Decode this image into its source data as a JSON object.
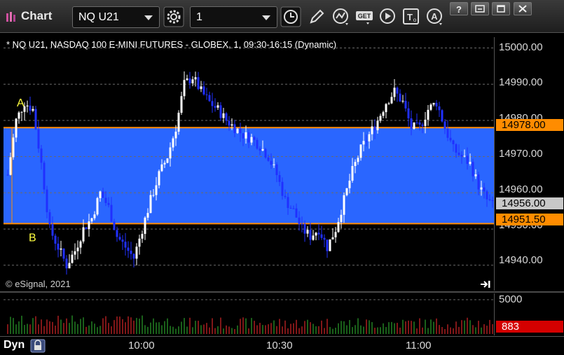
{
  "window": {
    "title": "Chart",
    "symbol_value": "NQ U21",
    "interval_value": "1"
  },
  "toolbar": {
    "icons": [
      "settings-icon",
      "clock-icon",
      "pencil-icon",
      "line-study-icon",
      "get-icon",
      "play-icon",
      "text-tool-icon",
      "alert-icon"
    ]
  },
  "chart": {
    "caption": "* NQ U21, NASDAQ 100 E-MINI FUTURES - GLOBEX, 1, 09:30-16:15 (Dynamic)",
    "copyright": "© eSignal, 2021",
    "marker_a": "A",
    "marker_b": "B",
    "price_ticks": [
      "15000.00",
      "14990.00",
      "14980.00",
      "14970.00",
      "14960.00",
      "14950.00",
      "14940.00"
    ],
    "upper_level": "14978.00",
    "last_price": "14956.00",
    "lower_level": "14951.50",
    "volume_tick": "5000",
    "volume_last": "883",
    "time_labels": [
      "10:00",
      "10:30",
      "11:00"
    ],
    "dyn_label": "Dyn",
    "colors": {
      "band": "#2a66ff",
      "band_border": "#ff8c00",
      "up_bar": "#ffffff",
      "down_bar": "#2030ff",
      "vol_up": "#2ca02c",
      "vol_down": "#d62728"
    }
  },
  "chart_data": {
    "type": "bar",
    "title": "* NQ U21, NASDAQ 100 E-MINI FUTURES - GLOBEX, 1, 09:30-16:15 (Dynamic)",
    "x": [
      "10:00",
      "10:30",
      "11:00"
    ],
    "ylim": [
      14934,
      15002
    ],
    "price_levels": {
      "upper": 14978.0,
      "lower": 14951.5,
      "last": 14956.0
    },
    "close_path": [
      14965,
      14980,
      14985,
      14983,
      14968,
      14950,
      14945,
      14940,
      14944,
      14950,
      14953,
      14960,
      14956,
      14948,
      14945,
      14942,
      14950,
      14958,
      14965,
      14970,
      14978,
      14990,
      14992,
      14988,
      14985,
      14983,
      14980,
      14978,
      14976,
      14975,
      14973,
      14970,
      14965,
      14958,
      14955,
      14950,
      14948,
      14950,
      14945,
      14950,
      14958,
      14966,
      14972,
      14976,
      14980,
      14985,
      14988,
      14985,
      14978,
      14978,
      14983,
      14985,
      14978,
      14972,
      14970,
      14968,
      14962,
      14958,
      14956
    ]
  }
}
